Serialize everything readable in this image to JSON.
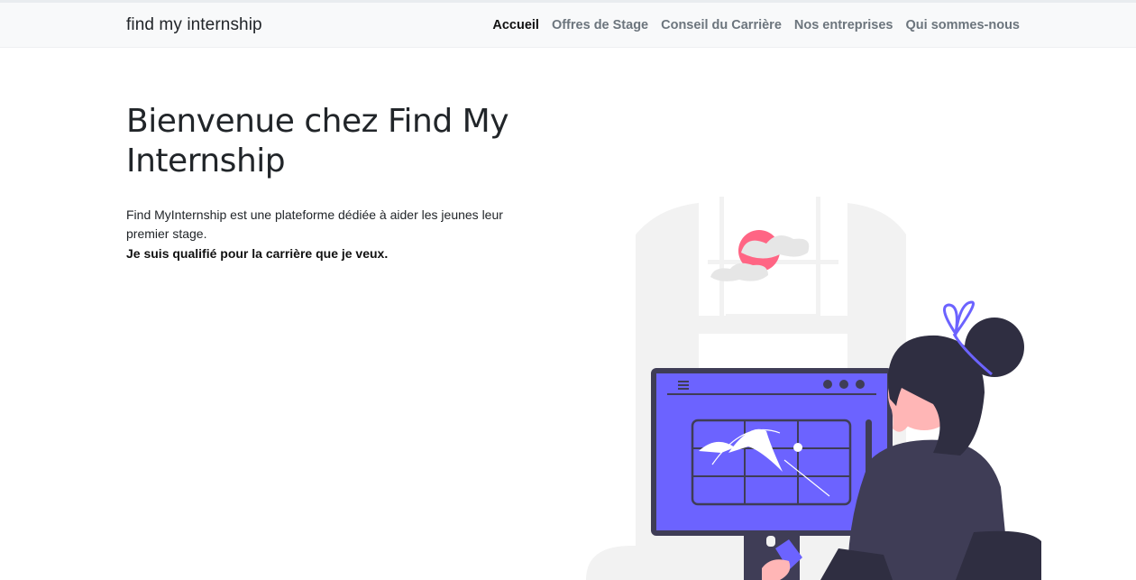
{
  "navbar": {
    "brand": "find my internship",
    "links": [
      {
        "label": "Accueil",
        "active": true
      },
      {
        "label": "Offres de Stage",
        "active": false
      },
      {
        "label": "Conseil du Carrière",
        "active": false
      },
      {
        "label": "Nos entreprises",
        "active": false
      },
      {
        "label": "Qui sommes-nous",
        "active": false
      }
    ]
  },
  "hero": {
    "title": "Bienvenue chez Find My Internship",
    "description": "Find MyInternship est une plateforme dédiée à aider les jeunes leur premier stage.",
    "tagline": "Je suis qualifié pour la carrière que je veux."
  },
  "colors": {
    "accent": "#6c63ff",
    "sun": "#ff6584",
    "navbar_bg": "#f8f9fa",
    "dark": "#2f2e41"
  }
}
